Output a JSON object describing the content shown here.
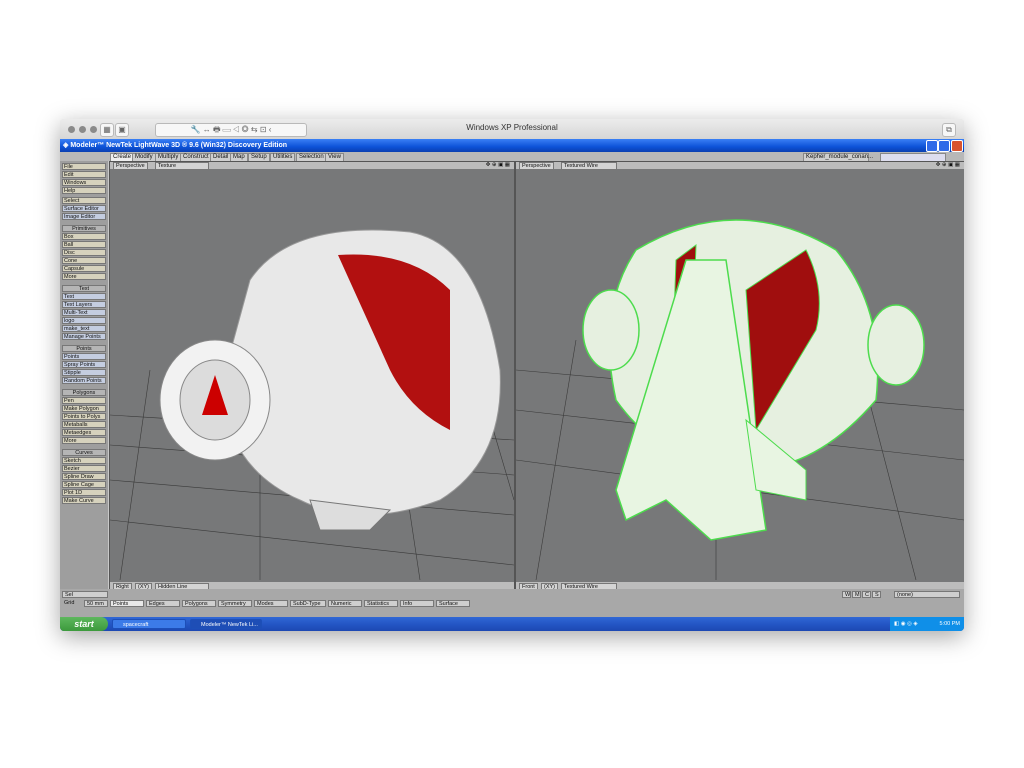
{
  "mac": {
    "title": "Windows XP Professional"
  },
  "xp": {
    "title": "Modeler™ NewTek LightWave 3D ® 9.6  (Win32) Discovery Edition",
    "tabs": [
      "Create",
      "Modify",
      "Multiply",
      "Construct",
      "Detail",
      "Map",
      "Setup",
      "Utilities",
      "Selection",
      "View"
    ],
    "object_select": "Kepher_module_conan..."
  },
  "sidebar": {
    "top": [
      "File",
      "Edit",
      "Windows",
      "Help",
      "Select",
      "Surface Editor",
      "Image Editor"
    ],
    "primitives_header": "Primitives",
    "primitives": [
      "Box",
      "Ball",
      "Disc",
      "Cone",
      "Capsule",
      "More"
    ],
    "text_header": "Text",
    "text": [
      "Text",
      "Text Layers",
      "Multi-Text",
      "logo",
      "make_text",
      "Manage Points"
    ],
    "points_header": "Points",
    "points": [
      "Points",
      "Spray Points",
      "Stipple",
      "Random Points"
    ],
    "polygons_header": "Polygons",
    "polygons": [
      "Pen",
      "Make Polygon",
      "Points to Polys",
      "Metaballs",
      "Metaedges",
      "More"
    ],
    "curves_header": "Curves",
    "curves": [
      "Sketch",
      "Bezier",
      "Spline Draw",
      "Spline Cage",
      "Plot 1D",
      "Make Curve"
    ]
  },
  "viewports": {
    "left_top": {
      "view": "Perspective",
      "mode": "Texture"
    },
    "right_top": {
      "view": "Perspective",
      "mode": "Textured Wire"
    },
    "left_bottom": {
      "view": "Right",
      "zoom": "(XY)",
      "mode": "Hidden Line"
    },
    "right_bottom": {
      "view": "Front",
      "zoom": "(XY)",
      "mode": "Textured Wire"
    }
  },
  "bottombar": {
    "grid_label": "Grid",
    "grid_value": "50 mm",
    "sel_label": "Sel",
    "modes": [
      "Points",
      "Edges",
      "Polygons",
      "Symmetry",
      "Modes",
      "SubD-Type",
      "Numeric",
      "Statistics",
      "Info",
      "Surface"
    ],
    "layers_label": "(none)",
    "wmcs": [
      "W",
      "M",
      "C",
      "S"
    ]
  },
  "taskbar": {
    "start": "start",
    "tasks": [
      "spacecraft",
      "Modeler™ NewTek Li..."
    ],
    "clock": "5:00 PM"
  }
}
